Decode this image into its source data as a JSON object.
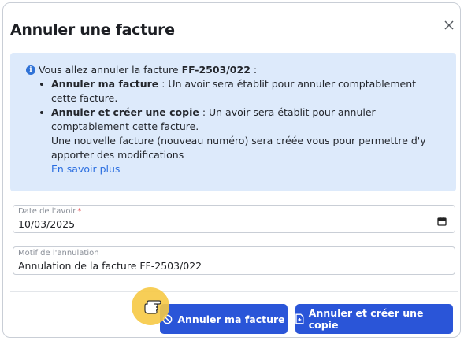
{
  "dialog": {
    "title": "Annuler une facture",
    "info": {
      "intro_prefix": "Vous allez annuler la facture ",
      "invoice_number": "FF-2503/022",
      "intro_suffix": " :",
      "items": [
        {
          "bold": "Annuler ma facture",
          "text": " : Un avoir sera établit pour annuler comptablement cette facture."
        },
        {
          "bold": "Annuler et créer une copie",
          "text": " : Un avoir sera établit pour annuler comptablement cette facture.",
          "extra": "Une nouvelle facture (nouveau numéro) sera créée vous pour permettre d'y apporter des modifications"
        }
      ],
      "link": "En savoir plus"
    },
    "fields": {
      "date": {
        "label": "Date de l'avoir",
        "required_mark": "*",
        "value": "10/03/2025"
      },
      "motif": {
        "label": "Motif de l'annulation",
        "value": "Annulation de la facture FF-2503/022"
      }
    },
    "buttons": {
      "cancel": "Annuler ma facture",
      "cancel_copy": "Annuler et créer une copie"
    },
    "colors": {
      "primary": "#2a55d8",
      "info_bg": "#ddeafb",
      "link": "#2a6ee0",
      "required": "#e5484d"
    }
  }
}
